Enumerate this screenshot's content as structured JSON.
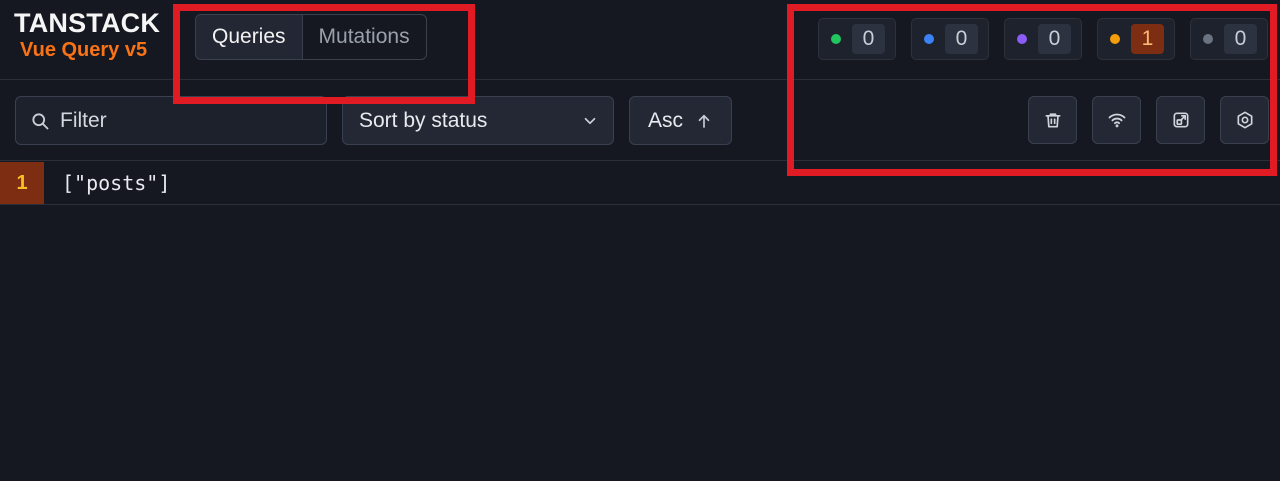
{
  "brand": {
    "title": "TANSTACK",
    "subtitle": "Vue Query v5"
  },
  "tabs": [
    {
      "label": "Queries",
      "active": true
    },
    {
      "label": "Mutations",
      "active": false
    }
  ],
  "status_badges": [
    {
      "status": "fresh",
      "color": "#22c55e",
      "count": "0"
    },
    {
      "status": "fetching",
      "color": "#3b82f6",
      "count": "0"
    },
    {
      "status": "paused",
      "color": "#8b5cf6",
      "count": "0"
    },
    {
      "status": "stale",
      "color": "#f59e0b",
      "count": "1"
    },
    {
      "status": "inactive",
      "color": "#6b7280",
      "count": "0"
    }
  ],
  "toolbar": {
    "filter_placeholder": "Filter",
    "sort_label": "Sort by status",
    "order_label": "Asc"
  },
  "actions": [
    {
      "icon": "trash-icon"
    },
    {
      "icon": "wifi-icon"
    },
    {
      "icon": "open-panel-icon"
    },
    {
      "icon": "settings-icon"
    }
  ],
  "queries": [
    {
      "observers": "1",
      "key": "[\"posts\"]"
    }
  ],
  "highlight_color": "#e01b24"
}
